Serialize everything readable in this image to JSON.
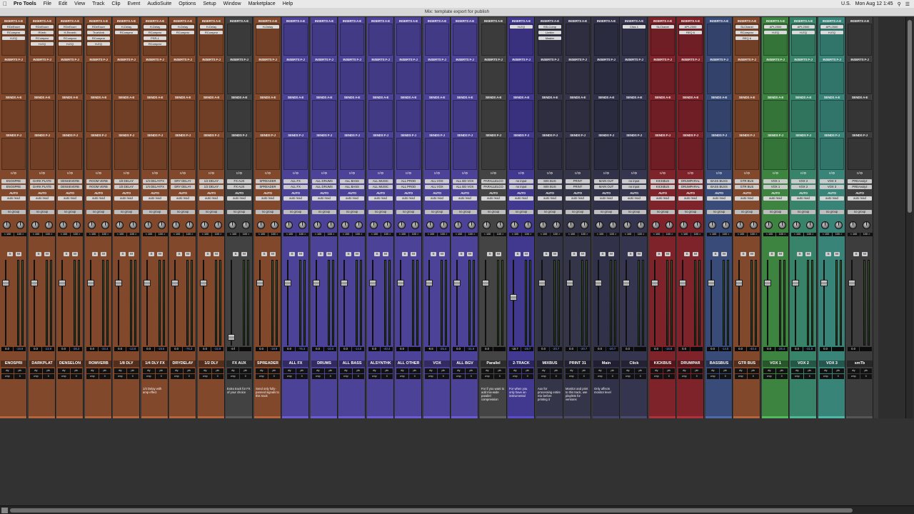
{
  "menubar": {
    "app": "Pro Tools",
    "items": [
      "File",
      "Edit",
      "View",
      "Track",
      "Clip",
      "Event",
      "AudioSuite",
      "Options",
      "Setup",
      "Window",
      "Marketplace",
      "Help"
    ],
    "locale": "U.S.",
    "clock": "Mon Aug 12 1:45"
  },
  "window": {
    "title": "Mix: template export for publish"
  },
  "labels": {
    "inserts": "INSERTS A-E",
    "inserts2": "INSERTS F-J",
    "sends": "SENDS A-E",
    "sends2": "SENDS F-J",
    "io": "I / O",
    "auto": "AUTO",
    "auto_mode": "auto read",
    "group": "no group",
    "m": "M",
    "s": "S"
  },
  "tracks": [
    {
      "name": "ENOSPRI",
      "color": "#b3643d",
      "io": "ENOSPRE",
      "pan": "",
      "vol": "0.0",
      "peak": "-18.9",
      "inserts": [
        "RDeEsser",
        "RComprsr",
        "H-EQ"
      ],
      "comment": ""
    },
    {
      "name": "DARKPLAT",
      "color": "#b3643d",
      "io": "DARK PLATE",
      "pan": "",
      "vol": "0.0",
      "peak": "-22.9",
      "inserts": [
        "RDeEsser",
        "RVerb",
        "RComprsr",
        "H-EQ"
      ],
      "comment": ""
    },
    {
      "name": "DENSELON",
      "color": "#b3643d",
      "io": "DENSEVERB",
      "pan": "",
      "vol": "0.0",
      "peak": "-36.3",
      "inserts": [
        "RDeEsser",
        "H-Reverb",
        "RComprsr",
        "H-EQ"
      ],
      "comment": ""
    },
    {
      "name": "ROMVERB",
      "color": "#b3643d",
      "io": "ROOM VERB",
      "pan": "",
      "vol": "0.0",
      "peak": "-34.4",
      "inserts": [
        "RDeEsser",
        "TrueVerb",
        "RComprsr",
        "H-EQ"
      ],
      "comment": ""
    },
    {
      "name": "1/8 DLY",
      "color": "#b3643d",
      "io": "1/8 DELAY",
      "pan": "",
      "vol": "0.0",
      "peak": "-13.8",
      "inserts": [
        "H-Delay",
        "RComprsr"
      ],
      "comment": ""
    },
    {
      "name": "1/4 DLY FX",
      "color": "#b3643d",
      "io": "1/4 DELAYFX",
      "pan": "",
      "vol": "0.0",
      "peak": "-19.5",
      "inserts": [
        "H-Delay",
        "RComprsr",
        "PSR-1",
        "RComprsr"
      ],
      "comment": "1/4 Delay with amp effect"
    },
    {
      "name": "DRYDELAY",
      "color": "#b3643d",
      "io": "DRY DELAY",
      "pan": "",
      "vol": "0.0",
      "peak": "-76.3",
      "inserts": [
        "H-Delay",
        "RComprsr"
      ],
      "comment": ""
    },
    {
      "name": "1/2 DLY",
      "color": "#b3643d",
      "io": "1/2 DELAY",
      "pan": "pan > 0",
      "vol": "0.0",
      "peak": "-32.9",
      "inserts": [
        "H-Delay",
        "RComprsr"
      ],
      "comment": ""
    },
    {
      "name": "FX AUX",
      "color": "#5b5b5b",
      "io": "FX AUX",
      "pan": "",
      "vol": "-inf",
      "peak": "",
      "inserts": [],
      "comment": "Extra track for FX of your choice"
    },
    {
      "name": "SPREADER",
      "color": "#b3643d",
      "io": "SPREADER",
      "pan": "",
      "vol": "0.0",
      "peak": "-18.9",
      "inserts": [
        "H-Delay"
      ],
      "comment": "Send only fully-panned signals to this track"
    },
    {
      "name": "ALL FX",
      "color": "#6a5bd2",
      "io": "ALL FX",
      "pan": "",
      "vol": "0.0",
      "peak": "-76.3",
      "inserts": [],
      "comment": ""
    },
    {
      "name": "DRUMS",
      "color": "#6a5bd2",
      "io": "ALL DRUMS",
      "pan": "",
      "vol": "0.0",
      "peak": "-10.0",
      "inserts": [],
      "comment": ""
    },
    {
      "name": "ALL BASS",
      "color": "#6a5bd2",
      "io": "ALL BASS",
      "pan": "",
      "vol": "0.0",
      "peak": "-14.0",
      "inserts": [],
      "comment": ""
    },
    {
      "name": "ALSYNTHK",
      "color": "#6a5bd2",
      "io": "ALL MUSIC",
      "pan": "",
      "vol": "0.0",
      "peak": "-40.4",
      "inserts": [],
      "comment": ""
    },
    {
      "name": "ALL OTHER",
      "color": "#6a5bd2",
      "io": "ALL PROD",
      "pan": "",
      "vol": "0.0",
      "peak": "",
      "inserts": [],
      "comment": ""
    },
    {
      "name": "VOX",
      "color": "#6a5bd2",
      "io": "ALL VOX",
      "pan": "",
      "vol": "-9.8",
      "peak": "-25.4",
      "inserts": [],
      "comment": ""
    },
    {
      "name": "ALL BGV",
      "color": "#6a5bd2",
      "io": "ALL BG VOX",
      "pan": "",
      "vol": "0.0",
      "peak": "-31.9",
      "inserts": [],
      "comment": ""
    },
    {
      "name": "Parallel",
      "color": "#5f5f5f",
      "io": "PARALLELCO",
      "pan": "",
      "vol": "0.0",
      "peak": "",
      "inserts": [],
      "comment": "For if you want to add mix-wide parallel compression"
    },
    {
      "name": "2-TRACK",
      "color": "#5a4ec8",
      "io": "no input",
      "pan": "",
      "vol": "-18.7",
      "peak": "-28.7",
      "inserts": [
        "H-EQ"
      ],
      "comment": "For when you only have an instrumental"
    },
    {
      "name": "MIXBUS",
      "color": "#4a4a66",
      "io": "MIX BUS",
      "pan": "",
      "vol": "0.0",
      "peak": "-20.7",
      "inserts": [
        "SSLComp",
        "Limiter",
        "Master"
      ],
      "comment": "Aux for processing entire mix before printing it"
    },
    {
      "name": "PRINT 31",
      "color": "#4a4a66",
      "io": "PRINT",
      "pan": "",
      "vol": "0.0",
      "peak": "-20.7",
      "inserts": [],
      "comment": "Monitor and print to this track, use playlists for versions"
    },
    {
      "name": "Main",
      "color": "#444466",
      "io": "MAIN OUT",
      "pan": "",
      "vol": "0.0",
      "peak": "-20.7",
      "inserts": [],
      "comment": "Only affects monitor level"
    },
    {
      "name": "Click",
      "color": "#4a4a6e",
      "io": "no input",
      "pan": "pan > 0",
      "vol": "0.0",
      "peak": "",
      "inserts": [
        "Click 1"
      ],
      "comment": ""
    },
    {
      "name": "KICKBUS",
      "color": "#b0303c",
      "io": "KICKBUS",
      "pan": "",
      "vol": "0.0",
      "peak": "-16.8",
      "inserts": [
        "SLChanel"
      ],
      "comment": ""
    },
    {
      "name": "DRUMPAR",
      "color": "#b0303c",
      "io": "DRUMPARAL",
      "pan": "",
      "vol": "0.0",
      "peak": "",
      "inserts": [
        "API-2500",
        "REQ 6"
      ],
      "comment": ""
    },
    {
      "name": "BASSBUS",
      "color": "#4f6aa8",
      "io": "BASS BUSS",
      "pan": "",
      "vol": "0.0",
      "peak": "-14.0",
      "inserts": [],
      "comment": ""
    },
    {
      "name": "GTR BUS",
      "color": "#b3643d",
      "io": "GTR BUS",
      "pan": "",
      "vol": "0.0",
      "peak": "-40.4",
      "inserts": [
        "SLChanel",
        "RComprsr",
        "REQ 6"
      ],
      "comment": ""
    },
    {
      "name": "VOX 1",
      "color": "#55b85a",
      "io": "VOX 1",
      "pan": "",
      "vol": "0.0",
      "peak": "-25.4",
      "inserts": [
        "API-2500",
        "H-EQ"
      ],
      "comment": ""
    },
    {
      "name": "VOX 2",
      "color": "#4eb894",
      "io": "VOX 2",
      "pan": "",
      "vol": "0.0",
      "peak": "-31.9",
      "inserts": [
        "API-2500",
        "H-EQ"
      ],
      "comment": ""
    },
    {
      "name": "VOX 3",
      "color": "#4eb8a8",
      "io": "VOX 3",
      "pan": "",
      "vol": "0.0",
      "peak": "",
      "inserts": [
        "API-2500",
        "H-EQ"
      ],
      "comment": ""
    },
    {
      "name": "smTb",
      "color": "#555555",
      "io": "PREAnalyz",
      "pan": "pan > 0",
      "vol": "0.0",
      "peak": "",
      "inserts": [],
      "comment": ""
    }
  ]
}
